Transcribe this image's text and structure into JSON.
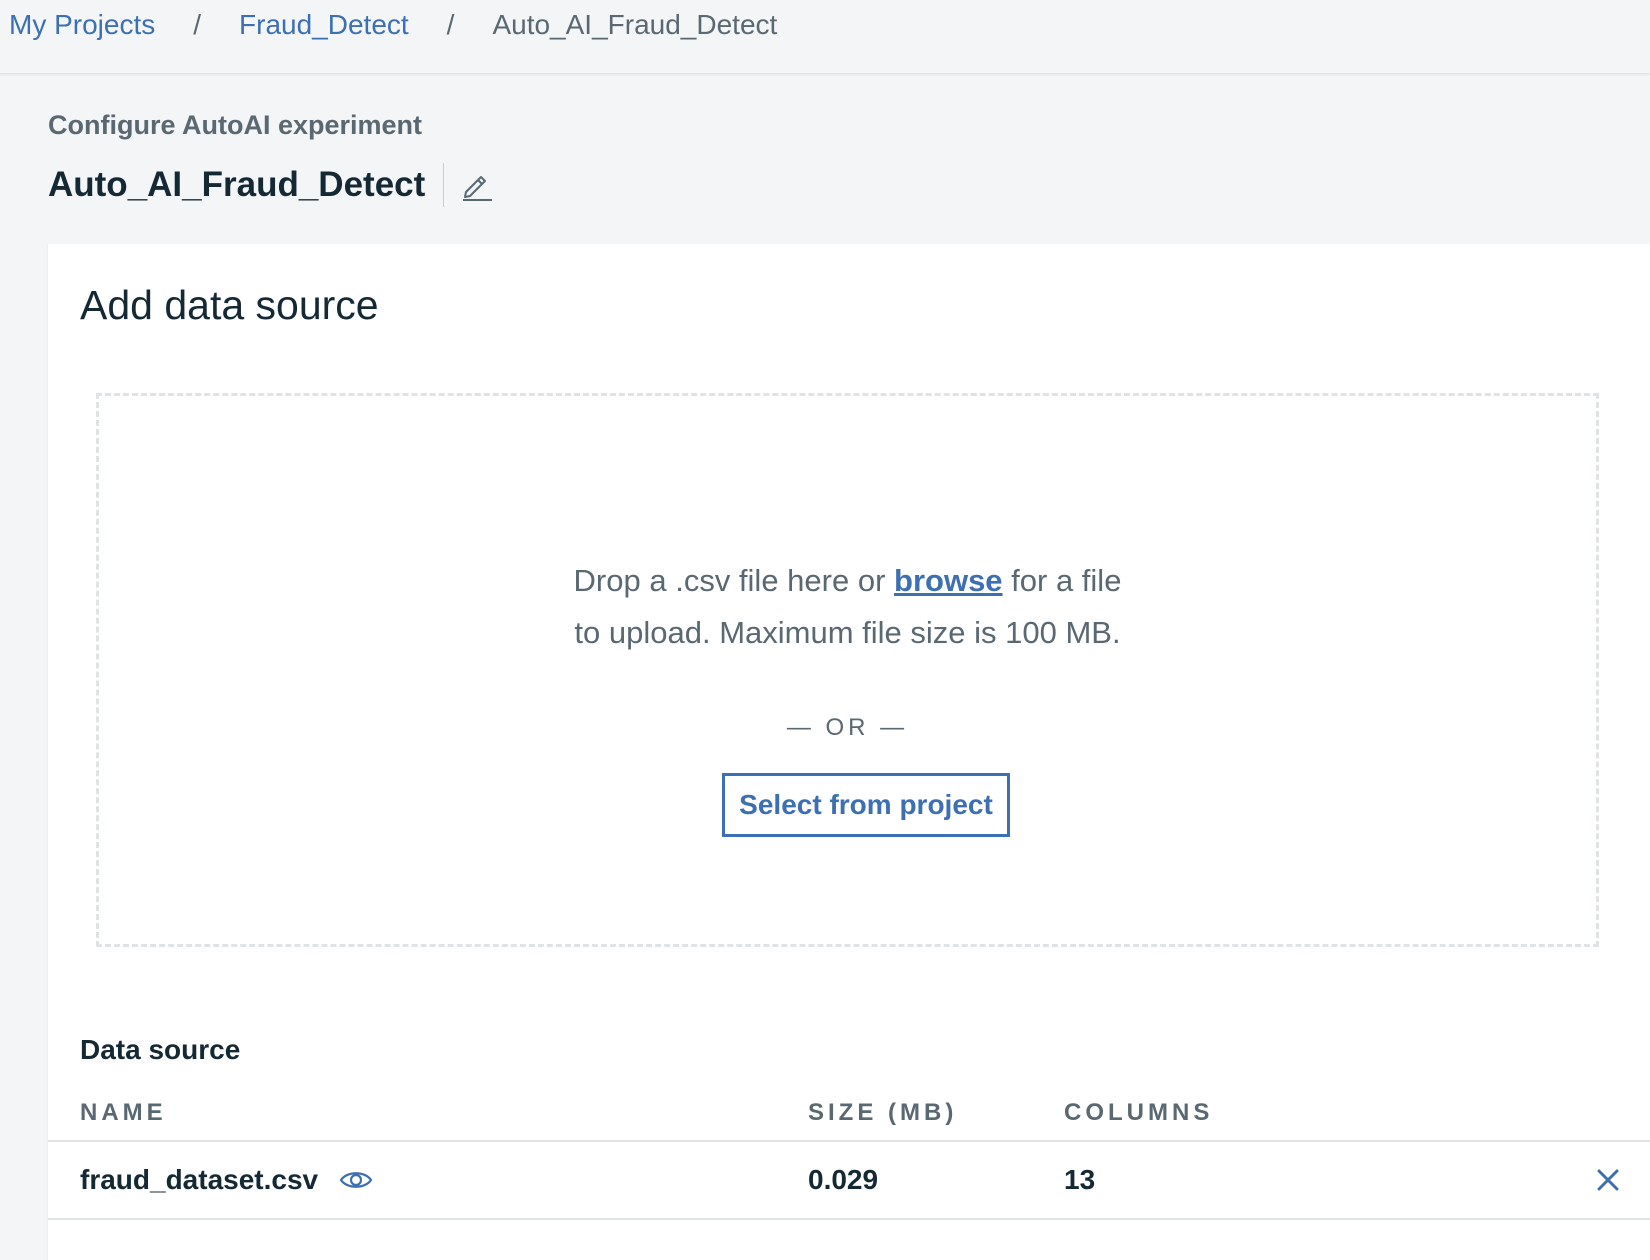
{
  "breadcrumb": {
    "items": [
      {
        "label": "My Projects"
      },
      {
        "label": "Fraud_Detect"
      },
      {
        "label": "Auto_AI_Fraud_Detect"
      }
    ],
    "separator": "/"
  },
  "header": {
    "subtitle": "Configure AutoAI experiment",
    "title": "Auto_AI_Fraud_Detect",
    "edit_icon": "pencil-icon"
  },
  "card": {
    "title": "Add data source",
    "dropzone": {
      "text_before_link": "Drop a .csv file here or ",
      "link_label": "browse",
      "text_after_link": " for a file",
      "line2": "to upload. Maximum file size is 100 MB.",
      "or_label": "— OR —",
      "select_button_label": "Select from project"
    },
    "data_source": {
      "heading": "Data source",
      "columns": [
        "NAME",
        "SIZE (MB)",
        "COLUMNS"
      ],
      "rows": [
        {
          "name": "fraud_dataset.csv",
          "size_mb": "0.029",
          "columns": "13",
          "preview_icon": "eye-icon",
          "remove_icon": "close-icon"
        }
      ]
    }
  },
  "colors": {
    "accent": "#3d70b2",
    "text_primary": "#152935",
    "text_secondary": "#5a6872",
    "page_background": "#f3f5f7",
    "border": "#dfe3e6"
  }
}
